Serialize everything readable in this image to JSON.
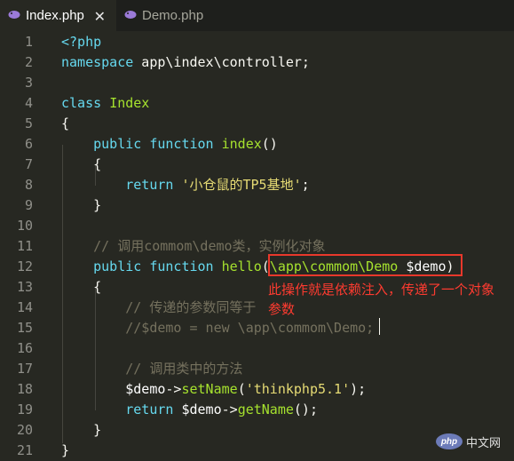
{
  "tabs": [
    {
      "label": "Index.php",
      "icon": "php-elephant-icon",
      "active": true,
      "close": "✕"
    },
    {
      "label": "Demo.php",
      "icon": "php-elephant-icon",
      "active": false
    }
  ],
  "lines": [
    {
      "n": "1",
      "tokens": [
        {
          "t": "<?php",
          "c": "k"
        }
      ]
    },
    {
      "n": "2",
      "tokens": [
        {
          "t": "namespace",
          "c": "k"
        },
        {
          "t": " app\\index\\controller;",
          "c": ""
        }
      ]
    },
    {
      "n": "3",
      "tokens": []
    },
    {
      "n": "4",
      "tokens": [
        {
          "t": "class",
          "c": "k"
        },
        {
          "t": " ",
          "c": ""
        },
        {
          "t": "Index",
          "c": "f"
        }
      ]
    },
    {
      "n": "5",
      "tokens": [
        {
          "t": "{",
          "c": ""
        }
      ]
    },
    {
      "n": "6",
      "tokens": [
        {
          "t": "    ",
          "c": ""
        },
        {
          "t": "public",
          "c": "k"
        },
        {
          "t": " ",
          "c": ""
        },
        {
          "t": "function",
          "c": "k"
        },
        {
          "t": " ",
          "c": ""
        },
        {
          "t": "index",
          "c": "f"
        },
        {
          "t": "()",
          "c": ""
        }
      ]
    },
    {
      "n": "7",
      "tokens": [
        {
          "t": "    {",
          "c": ""
        }
      ]
    },
    {
      "n": "8",
      "tokens": [
        {
          "t": "        ",
          "c": ""
        },
        {
          "t": "return",
          "c": "k"
        },
        {
          "t": " ",
          "c": ""
        },
        {
          "t": "'小仓鼠的TP5基地'",
          "c": "s"
        },
        {
          "t": ";",
          "c": ""
        }
      ]
    },
    {
      "n": "9",
      "tokens": [
        {
          "t": "    }",
          "c": ""
        }
      ]
    },
    {
      "n": "10",
      "tokens": []
    },
    {
      "n": "11",
      "tokens": [
        {
          "t": "    ",
          "c": ""
        },
        {
          "t": "// 调用commom\\demo类，实例化对象",
          "c": "c"
        }
      ]
    },
    {
      "n": "12",
      "tokens": [
        {
          "t": "    ",
          "c": ""
        },
        {
          "t": "public",
          "c": "k"
        },
        {
          "t": " ",
          "c": ""
        },
        {
          "t": "function",
          "c": "k"
        },
        {
          "t": " ",
          "c": ""
        },
        {
          "t": "hello",
          "c": "f"
        },
        {
          "t": "(",
          "c": ""
        },
        {
          "t": "\\app\\commom\\Demo",
          "c": "f"
        },
        {
          "t": " ",
          "c": ""
        },
        {
          "t": "$demo",
          "c": "v"
        },
        {
          "t": ")",
          "c": ""
        }
      ]
    },
    {
      "n": "13",
      "tokens": [
        {
          "t": "    {",
          "c": ""
        }
      ]
    },
    {
      "n": "14",
      "tokens": [
        {
          "t": "        ",
          "c": ""
        },
        {
          "t": "// 传递的参数同等于",
          "c": "c"
        }
      ]
    },
    {
      "n": "15",
      "tokens": [
        {
          "t": "        ",
          "c": ""
        },
        {
          "t": "//$demo = new \\app\\commom\\Demo;",
          "c": "c"
        }
      ]
    },
    {
      "n": "16",
      "tokens": []
    },
    {
      "n": "17",
      "tokens": [
        {
          "t": "        ",
          "c": ""
        },
        {
          "t": "// 调用类中的方法",
          "c": "c"
        }
      ]
    },
    {
      "n": "18",
      "tokens": [
        {
          "t": "        ",
          "c": ""
        },
        {
          "t": "$demo",
          "c": "v"
        },
        {
          "t": "->",
          "c": ""
        },
        {
          "t": "setName",
          "c": "f"
        },
        {
          "t": "(",
          "c": ""
        },
        {
          "t": "'thinkphp5.1'",
          "c": "s"
        },
        {
          "t": ");",
          "c": ""
        }
      ]
    },
    {
      "n": "19",
      "tokens": [
        {
          "t": "        ",
          "c": ""
        },
        {
          "t": "return",
          "c": "k"
        },
        {
          "t": " ",
          "c": ""
        },
        {
          "t": "$demo",
          "c": "v"
        },
        {
          "t": "->",
          "c": ""
        },
        {
          "t": "getName",
          "c": "f"
        },
        {
          "t": "();",
          "c": ""
        }
      ]
    },
    {
      "n": "20",
      "tokens": [
        {
          "t": "    }",
          "c": ""
        }
      ]
    },
    {
      "n": "21",
      "tokens": [
        {
          "t": "}",
          "c": ""
        }
      ]
    }
  ],
  "annotation": {
    "line1": "此操作就是依赖注入，传递了一个对象",
    "line2": "参数"
  },
  "watermark": {
    "logo": "php",
    "text": "中文网"
  },
  "colors": {
    "background": "#272822",
    "keyword": "#66d9ef",
    "string": "#e6db74",
    "comment": "#75715e",
    "function": "#a6e22e",
    "annotation": "#ff3b30",
    "highlight_border": "#e8382b"
  }
}
